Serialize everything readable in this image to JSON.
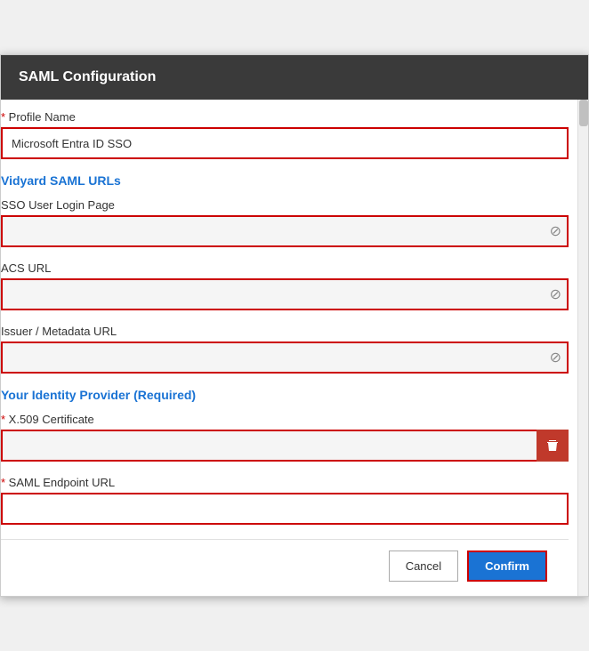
{
  "modal": {
    "title": "SAML Configuration"
  },
  "form": {
    "profile_name_label": "Profile Name",
    "profile_name_value": "Microsoft Entra ID SSO",
    "vidyard_saml_section": "Vidyard SAML URLs",
    "sso_user_login_label": "SSO User Login Page",
    "sso_user_login_value": "",
    "acs_url_label": "ACS URL",
    "acs_url_value": "",
    "issuer_metadata_label": "Issuer / Metadata URL",
    "issuer_metadata_value": "",
    "identity_provider_section": "Your Identity Provider (Required)",
    "x509_label": "X.509 Certificate",
    "x509_value": "",
    "saml_endpoint_label": "SAML Endpoint URL",
    "saml_endpoint_value": ""
  },
  "footer": {
    "cancel_label": "Cancel",
    "confirm_label": "Confirm"
  },
  "icons": {
    "copy": "⊘",
    "delete": "trash"
  }
}
